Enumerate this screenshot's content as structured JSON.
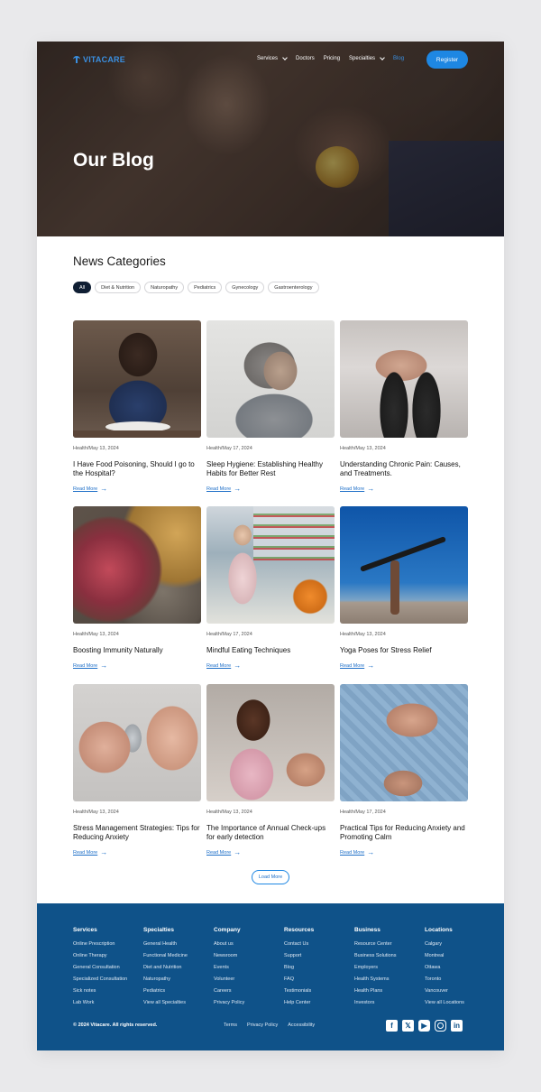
{
  "brand": {
    "name": "VITACARE"
  },
  "nav": {
    "items": [
      {
        "label": "Services",
        "dropdown": true
      },
      {
        "label": "Doctors",
        "dropdown": false
      },
      {
        "label": "Pricing",
        "dropdown": false
      },
      {
        "label": "Specialties",
        "dropdown": true
      },
      {
        "label": "Blog",
        "dropdown": false,
        "active": true
      }
    ],
    "register_label": "Register"
  },
  "hero": {
    "title": "Our Blog"
  },
  "categories": {
    "title": "News Categories",
    "chips": [
      "All",
      "Diet & Nutrition",
      "Naturopathy",
      "Pediatrics",
      "Gynecology",
      "Gastroenterology"
    ],
    "selected": "All"
  },
  "posts": [
    {
      "meta": "Health/May 13, 2024",
      "title": "I Have Food Poisoning, Should I go to the Hospital?",
      "read_more": "Read More",
      "image": "person covering eyes at table"
    },
    {
      "meta": "Health/May 17, 2024",
      "title": "Sleep Hygiene: Establishing Healthy Habits for Better Rest",
      "read_more": "Read More",
      "image": "woman sleeping on pillow"
    },
    {
      "meta": "Health/May 13, 2024",
      "title": "Understanding Chronic Pain: Causes, and Treatments.",
      "read_more": "Read More",
      "image": "hands holding knee"
    },
    {
      "meta": "Health/May 13, 2024",
      "title": "Boosting Immunity Naturally",
      "read_more": "Read More",
      "image": "berries and bowls"
    },
    {
      "meta": "Health/May 17, 2024",
      "title": "Mindful Eating Techniques",
      "read_more": "Read More",
      "image": "woman shopping groceries"
    },
    {
      "meta": "Health/May 13, 2024",
      "title": "Yoga Poses for Stress Relief",
      "read_more": "Read More",
      "image": "yoga handstand pose"
    },
    {
      "meta": "Health/May 13, 2024",
      "title": "Stress Management Strategies: Tips for Reducing Anxiety",
      "read_more": "Read More",
      "image": "hands with pills"
    },
    {
      "meta": "Health/May 13, 2024",
      "title": "The Importance of Annual Check-ups for early detection",
      "read_more": "Read More",
      "image": "mother and sick child"
    },
    {
      "meta": "Health/May 17, 2024",
      "title": "Practical Tips for Reducing Anxiety and Promoting Calm",
      "read_more": "Read More",
      "image": "hands on chest"
    }
  ],
  "load_more": "Load More",
  "footer": {
    "columns": [
      {
        "heading": "Services",
        "links": [
          "Online Prescription",
          "Online Therapy",
          "General Consultation",
          "Specialized Consultation",
          "Sick notes",
          "Lab Work"
        ]
      },
      {
        "heading": "Specialties",
        "links": [
          "General Health",
          "Functional Medicine",
          "Diet and Nutrition",
          "Naturopathy",
          "Pediatrics",
          "View all Specialties"
        ]
      },
      {
        "heading": "Company",
        "links": [
          "About us",
          "Newsroom",
          "Events",
          "Volunteer",
          "Careers",
          "Privacy Policy"
        ]
      },
      {
        "heading": "Resources",
        "links": [
          "Contact Us",
          "Support",
          "Blog",
          "FAQ",
          "Testimonials",
          "Help Center"
        ]
      },
      {
        "heading": "Business",
        "links": [
          "Resource Center",
          "Business Solutions",
          "Employers",
          "Health Systems",
          "Health Plans",
          "Investors"
        ]
      },
      {
        "heading": "Locations",
        "links": [
          "Calgary",
          "Montreal",
          "Ottawa",
          "Toronto",
          "Vancouver",
          "View all Locations"
        ]
      }
    ],
    "copyright": "© 2024 Vitacare. All rights reserved.",
    "bottom_links": [
      "Terms",
      "Privacy Policy",
      "Accessibility"
    ],
    "socials": [
      {
        "icon": "facebook-icon",
        "glyph": "f"
      },
      {
        "icon": "x-icon",
        "glyph": "𝕏"
      },
      {
        "icon": "youtube-icon",
        "glyph": "▶"
      },
      {
        "icon": "instagram-icon",
        "glyph": ""
      },
      {
        "icon": "linkedin-icon",
        "glyph": "in"
      }
    ]
  },
  "colors": {
    "accent": "#1e87e3",
    "footer_bg": "#0f5289",
    "chip_selected": "#0f1e33"
  }
}
